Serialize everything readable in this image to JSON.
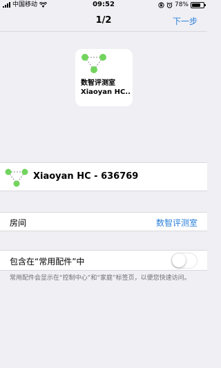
{
  "status_bar": {
    "carrier": "中国移动",
    "time": "09:52",
    "battery_percent": "78%",
    "battery_level": 0.78
  },
  "nav": {
    "title": "1/2",
    "next_label": "下一步"
  },
  "tile": {
    "room": "数智评测室",
    "name": "Xiaoyan HC..."
  },
  "device": {
    "name": "Xiaoyan HC - 636769"
  },
  "room_row": {
    "label": "房间",
    "value": "数智评测室"
  },
  "favorites": {
    "label": "包含在“常用配件”中",
    "enabled": false,
    "footnote": "常用配件会显示在“控制中心”和“家庭”标签页，以便您快速访问。"
  },
  "colors": {
    "accent": "#2b7fd8",
    "icon_green": "#72d45e",
    "background": "#efeff4"
  }
}
